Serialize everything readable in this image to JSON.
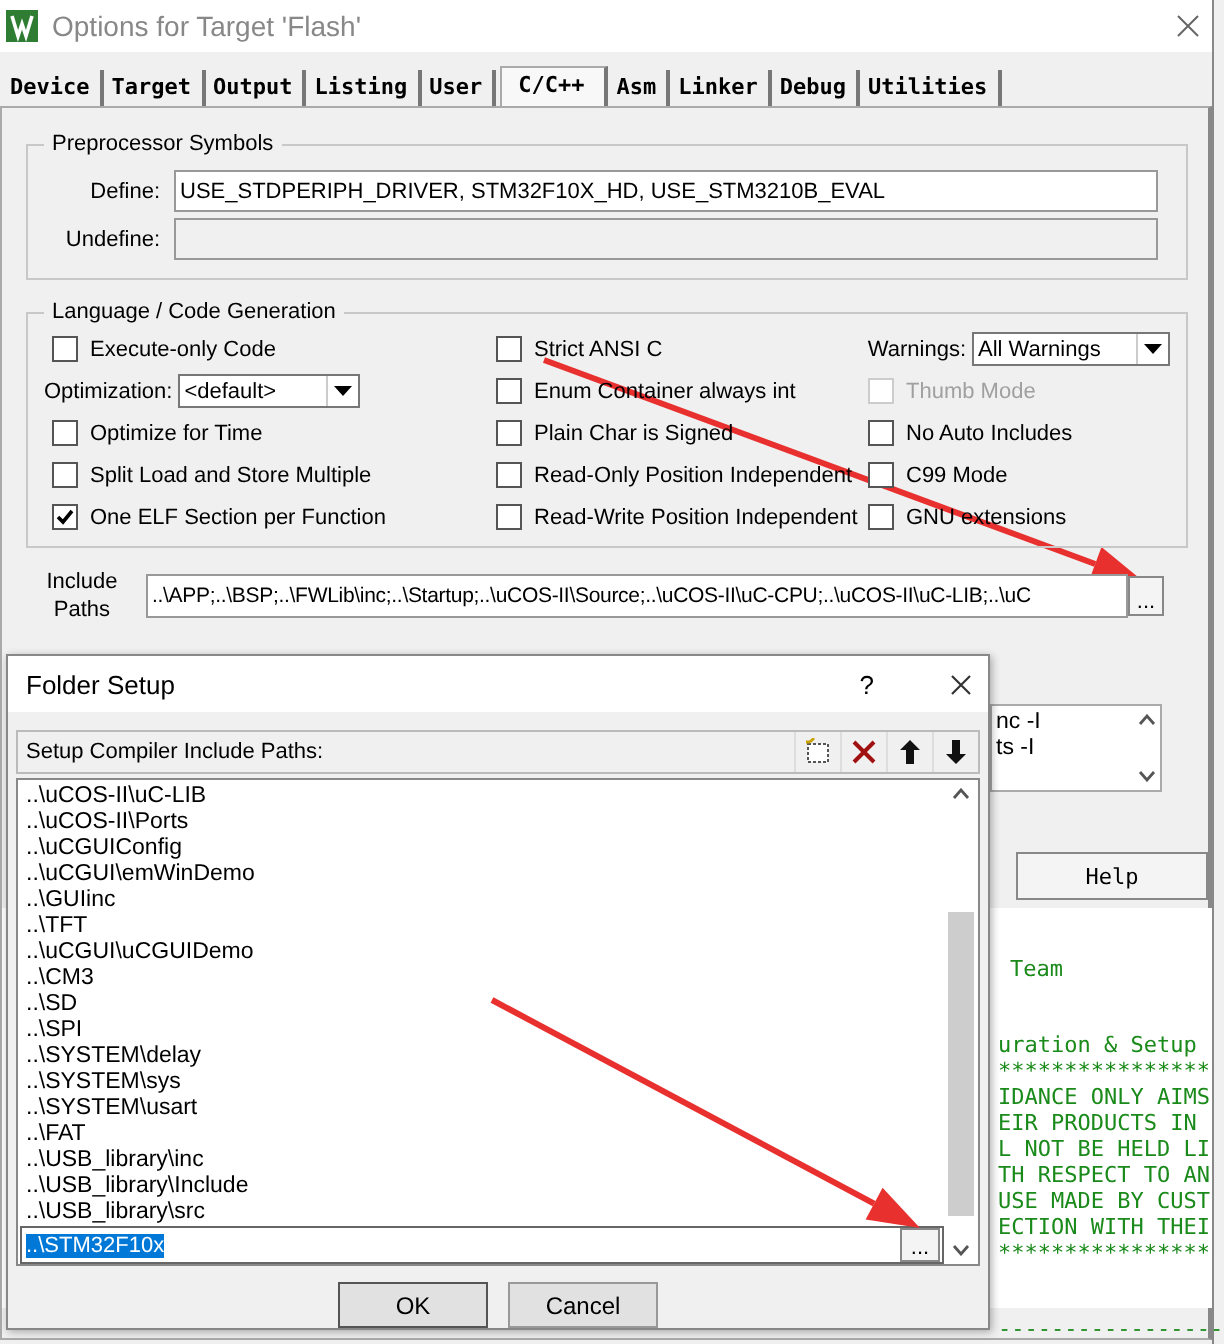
{
  "window": {
    "title": "Options for Target 'Flash'"
  },
  "tabs": [
    {
      "label": "Device",
      "selected": false
    },
    {
      "label": "Target",
      "selected": false
    },
    {
      "label": "Output",
      "selected": false
    },
    {
      "label": "Listing",
      "selected": false
    },
    {
      "label": "User",
      "selected": false
    },
    {
      "label": "C/C++",
      "selected": true
    },
    {
      "label": "Asm",
      "selected": false
    },
    {
      "label": "Linker",
      "selected": false
    },
    {
      "label": "Debug",
      "selected": false
    },
    {
      "label": "Utilities",
      "selected": false
    }
  ],
  "preprocessor": {
    "title": "Preprocessor Symbols",
    "define_label": "Define:",
    "define_value": "USE_STDPERIPH_DRIVER, STM32F10X_HD, USE_STM3210B_EVAL",
    "undefine_label": "Undefine:"
  },
  "code_generation": {
    "title": "Language / Code Generation",
    "columns": [
      [
        {
          "kind": "checkbox",
          "label": "Execute-only Code",
          "checked": false,
          "disabled": false
        },
        {
          "kind": "dropdown",
          "label": "Optimization:",
          "value": "<default>"
        },
        {
          "kind": "checkbox",
          "label": "Optimize for Time",
          "checked": false,
          "disabled": false
        },
        {
          "kind": "checkbox",
          "label": "Split Load and Store Multiple",
          "checked": false,
          "disabled": false
        },
        {
          "kind": "checkbox",
          "label": "One ELF Section per Function",
          "checked": true,
          "disabled": false
        }
      ],
      [
        {
          "kind": "checkbox",
          "label": "Strict ANSI C",
          "checked": false,
          "disabled": false
        },
        {
          "kind": "checkbox",
          "label": "Enum Container always int",
          "checked": false,
          "disabled": false
        },
        {
          "kind": "checkbox",
          "label": "Plain Char is Signed",
          "checked": false,
          "disabled": false
        },
        {
          "kind": "checkbox",
          "label": "Read-Only Position Independent",
          "checked": false,
          "disabled": false
        },
        {
          "kind": "checkbox",
          "label": "Read-Write Position Independent",
          "checked": false,
          "disabled": false
        }
      ],
      [
        {
          "kind": "dropdown",
          "label": "Warnings:",
          "value": "All Warnings"
        },
        {
          "kind": "checkbox",
          "label": "Thumb Mode",
          "checked": false,
          "disabled": true
        },
        {
          "kind": "checkbox",
          "label": "No Auto Includes",
          "checked": false,
          "disabled": false
        },
        {
          "kind": "checkbox",
          "label": "C99 Mode",
          "checked": false,
          "disabled": false
        },
        {
          "kind": "checkbox",
          "label": "GNU extensions",
          "checked": false,
          "disabled": false
        }
      ]
    ]
  },
  "include_paths": {
    "label": "Include Paths",
    "value": "..\\APP;..\\BSP;..\\FWLib\\inc;..\\Startup;..\\uCOS-II\\Source;..\\uCOS-II\\uC-CPU;..\\uCOS-II\\uC-LIB;..\\uC",
    "browse": "..."
  },
  "compiler_control": {
    "lines": [
      "nc -I",
      "ts -I"
    ]
  },
  "help_button": "Help",
  "editor": {
    "groups": [
      {
        "lines": [
          "Team"
        ]
      },
      {
        "lines": [
          "uration & Setup",
          "****************",
          "IDANCE ONLY AIMS",
          "EIR PRODUCTS IN",
          "L NOT BE HELD LI",
          "TH RESPECT TO AN",
          "USE MADE BY CUST",
          "ECTION WITH THEI",
          "****************"
        ]
      },
      {
        "lines": [
          "-----------------"
        ]
      }
    ]
  },
  "folder_setup": {
    "title": "Folder Setup",
    "help": "?",
    "label": "Setup Compiler Include Paths:",
    "paths": [
      "..\\uCOS-II\\uC-LIB",
      "..\\uCOS-II\\Ports",
      "..\\uCGUIConfig",
      "..\\uCGUI\\emWinDemo",
      "..\\GUIinc",
      "..\\TFT",
      "..\\uCGUI\\uCGUIDemo",
      "..\\CM3",
      "..\\SD",
      "..\\SPI",
      "..\\SYSTEM\\delay",
      "..\\SYSTEM\\sys",
      "..\\SYSTEM\\usart",
      "..\\FAT",
      "..\\USB_library\\inc",
      "..\\USB_library\\Include",
      "..\\USB_library\\src"
    ],
    "editing_value": "..\\STM32F10x",
    "browse": "...",
    "buttons": [
      "OK",
      "Cancel"
    ]
  }
}
